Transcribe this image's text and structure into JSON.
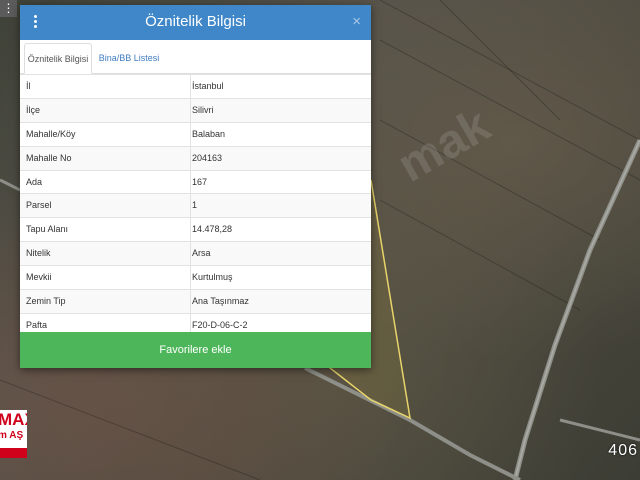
{
  "dialog": {
    "title": "Öznitelik Bilgisi",
    "close_symbol": "×",
    "tabs": [
      {
        "label": "Öznitelik Bilgisi",
        "active": true
      },
      {
        "label": "Bina/BB Listesi",
        "active": false
      }
    ],
    "rows": [
      {
        "key": "İl",
        "value": "İstanbul"
      },
      {
        "key": "İlçe",
        "value": "Silivri"
      },
      {
        "key": "Mahalle/Köy",
        "value": "Balaban"
      },
      {
        "key": "Mahalle No",
        "value": "204163"
      },
      {
        "key": "Ada",
        "value": "167"
      },
      {
        "key": "Parsel",
        "value": "1"
      },
      {
        "key": "Tapu Alanı",
        "value": "14.478,28"
      },
      {
        "key": "Nitelik",
        "value": "Arsa"
      },
      {
        "key": "Mevkii",
        "value": "Kurtulmuş"
      },
      {
        "key": "Zemin Tip",
        "value": "Ana Taşınmaz"
      },
      {
        "key": "Pafta",
        "value": "F20-D-06-C-2"
      }
    ],
    "favorite_button": "Favorilere ekle"
  },
  "map": {
    "watermark": "mak",
    "scale_text": "406",
    "logo_text": "MAX",
    "logo_subtext": "m AŞ",
    "menu_symbol": "⋮"
  },
  "colors": {
    "header": "#3f87c9",
    "favorite_button": "#4eb65a",
    "parcel_outline": "#e8d46a",
    "logo_red": "#d0021b"
  }
}
